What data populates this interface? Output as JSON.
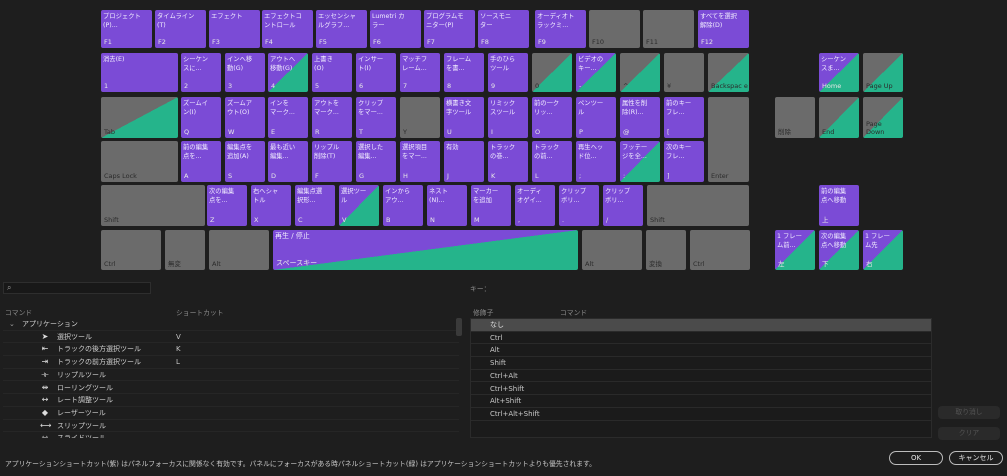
{
  "colors": {
    "application": "#7b4bd6",
    "panel": "#25b48b",
    "unassigned": "#6b6b6b",
    "background": "#1e1e1e"
  },
  "keyboard": {
    "keys": [
      {
        "id": "f1",
        "label": "F1",
        "cmd": "プロジェクト\n(P)...",
        "type": "app"
      },
      {
        "id": "f2",
        "label": "F2",
        "cmd": "タイムライン\n(T)",
        "type": "app"
      },
      {
        "id": "f3",
        "label": "F3",
        "cmd": "エフェクト",
        "type": "app"
      },
      {
        "id": "f4",
        "label": "F4",
        "cmd": "エフェクトコ\nントロール",
        "type": "app"
      },
      {
        "id": "f5",
        "label": "F5",
        "cmd": "エッセンシャ\nルグラフ...",
        "type": "app"
      },
      {
        "id": "f6",
        "label": "F6",
        "cmd": "Lumetri カ\nラー",
        "type": "app"
      },
      {
        "id": "f7",
        "label": "F7",
        "cmd": "プログラムモ\nニター(P)",
        "type": "app"
      },
      {
        "id": "f8",
        "label": "F8",
        "cmd": "ソースモニ\nター",
        "type": "app"
      },
      {
        "id": "f9",
        "label": "F9",
        "cmd": "オーディオト\nラックミ...",
        "type": "app"
      },
      {
        "id": "f10",
        "label": "F10",
        "cmd": "",
        "type": "gray"
      },
      {
        "id": "f11",
        "label": "F11",
        "cmd": "",
        "type": "gray"
      },
      {
        "id": "f12",
        "label": "F12",
        "cmd": "すべてを選択\n解除(D)",
        "type": "app"
      },
      {
        "id": "k1",
        "label": "1",
        "cmd": "消去(E)",
        "type": "app"
      },
      {
        "id": "k2",
        "label": "2",
        "cmd": "シーケン\nスに...",
        "type": "app"
      },
      {
        "id": "k3",
        "label": "3",
        "cmd": "インへ移\n動(G)",
        "type": "app"
      },
      {
        "id": "k4",
        "label": "4",
        "cmd": "アウトへ\n移動(G)",
        "type": "mix app"
      },
      {
        "id": "k5",
        "label": "5",
        "cmd": "上書き\n(O)",
        "type": "app"
      },
      {
        "id": "k6",
        "label": "6",
        "cmd": "インサー\nト(I)",
        "type": "app"
      },
      {
        "id": "k7",
        "label": "7",
        "cmd": "マッチフ\nレーム...",
        "type": "app"
      },
      {
        "id": "k8",
        "label": "8",
        "cmd": "フレーム\nを書...",
        "type": "app"
      },
      {
        "id": "k9",
        "label": "9",
        "cmd": "手のひら\nツール",
        "type": "app"
      },
      {
        "id": "k0",
        "label": "0",
        "cmd": "",
        "type": "mix gray"
      },
      {
        "id": "kminus",
        "label": "-",
        "cmd": "ビデオの\nキー...",
        "type": "mix app"
      },
      {
        "id": "kcaret",
        "label": "^",
        "cmd": "",
        "type": "mix gray"
      },
      {
        "id": "kyen",
        "label": "¥",
        "cmd": "",
        "type": "gray"
      },
      {
        "id": "kbs",
        "label": "Backspac\ne",
        "cmd": "",
        "type": "mix gray"
      },
      {
        "id": "ktab",
        "label": "Tab",
        "cmd": "",
        "type": "mix gray"
      },
      {
        "id": "kq",
        "label": "Q",
        "cmd": "ズームイ\nン(I)",
        "type": "app"
      },
      {
        "id": "kw",
        "label": "W",
        "cmd": "ズームア\nウト(O)",
        "type": "app"
      },
      {
        "id": "ke",
        "label": "E",
        "cmd": "インを\nマーク...",
        "type": "app"
      },
      {
        "id": "kr",
        "label": "R",
        "cmd": "アウトを\nマーク...",
        "type": "app"
      },
      {
        "id": "kt",
        "label": "T",
        "cmd": "クリップ\nをマー...",
        "type": "app"
      },
      {
        "id": "ky",
        "label": "Y",
        "cmd": "",
        "type": "gray"
      },
      {
        "id": "ku",
        "label": "U",
        "cmd": "横書き文\n字ツール",
        "type": "app"
      },
      {
        "id": "ki",
        "label": "I",
        "cmd": "リミック\nスツール",
        "type": "app"
      },
      {
        "id": "ko",
        "label": "O",
        "cmd": "前の一ク\nリッ...",
        "type": "app"
      },
      {
        "id": "kp",
        "label": "P",
        "cmd": "ペンツー\nル",
        "type": "app"
      },
      {
        "id": "kat",
        "label": "@",
        "cmd": "属性を削\n除(R)...",
        "type": "app"
      },
      {
        "id": "klb",
        "label": "[",
        "cmd": "前のキー\nフレ...",
        "type": "app"
      },
      {
        "id": "kenter",
        "label": "Enter",
        "cmd": "",
        "type": "gray"
      },
      {
        "id": "kcaps",
        "label": "Caps Lock",
        "cmd": "",
        "type": "gray"
      },
      {
        "id": "ka",
        "label": "A",
        "cmd": "前の編集\n点を...",
        "type": "app"
      },
      {
        "id": "ks",
        "label": "S",
        "cmd": "編集点を\n追加(A)",
        "type": "app"
      },
      {
        "id": "kd",
        "label": "D",
        "cmd": "最も近い\n編集...",
        "type": "app"
      },
      {
        "id": "kf",
        "label": "F",
        "cmd": "リップル\n削除(T)",
        "type": "app"
      },
      {
        "id": "kg",
        "label": "G",
        "cmd": "選択した\n編集...",
        "type": "app"
      },
      {
        "id": "kh",
        "label": "H",
        "cmd": "選択項目\nをマー...",
        "type": "app"
      },
      {
        "id": "kj",
        "label": "J",
        "cmd": "有効",
        "type": "app"
      },
      {
        "id": "kk",
        "label": "K",
        "cmd": "トラック\nの巻...",
        "type": "app"
      },
      {
        "id": "kl",
        "label": "L",
        "cmd": "トラック\nの前...",
        "type": "app"
      },
      {
        "id": "ksemi",
        "label": ";",
        "cmd": "再生ヘッ\nド位...",
        "type": "app"
      },
      {
        "id": "kcolon",
        "label": ":",
        "cmd": "フッテー\nジを全...",
        "type": "mix app"
      },
      {
        "id": "krb",
        "label": "]",
        "cmd": "次のキー\nフレ...",
        "type": "app"
      },
      {
        "id": "kshiftl",
        "label": "Shift",
        "cmd": "",
        "type": "gray"
      },
      {
        "id": "kz",
        "label": "Z",
        "cmd": "次の編集\n点を...",
        "type": "app"
      },
      {
        "id": "kx",
        "label": "X",
        "cmd": "右へシャ\nトル",
        "type": "app"
      },
      {
        "id": "kc",
        "label": "C",
        "cmd": "編集点選\n択形...",
        "type": "app"
      },
      {
        "id": "kv",
        "label": "V",
        "cmd": "選択ツー\nル",
        "type": "mix app"
      },
      {
        "id": "kb",
        "label": "B",
        "cmd": "インから\nアウ...",
        "type": "app"
      },
      {
        "id": "kn",
        "label": "N",
        "cmd": "ネスト\n(N)...",
        "type": "app"
      },
      {
        "id": "km",
        "label": "M",
        "cmd": "マーカー\nを追加",
        "type": "app"
      },
      {
        "id": "kcomma",
        "label": ",",
        "cmd": "オーディ\nオゲイ...",
        "type": "app"
      },
      {
        "id": "kperiod",
        "label": ".",
        "cmd": "クリップ\nボリ...",
        "type": "app"
      },
      {
        "id": "kslash",
        "label": "/",
        "cmd": "クリップ\nボリ...",
        "type": "app"
      },
      {
        "id": "kshiftr",
        "label": "Shift",
        "cmd": "",
        "type": "gray"
      },
      {
        "id": "kctrl",
        "label": "Ctrl",
        "cmd": "",
        "type": "gray"
      },
      {
        "id": "kmuhenkan",
        "label": "無変",
        "cmd": "",
        "type": "gray"
      },
      {
        "id": "kalt",
        "label": "Alt",
        "cmd": "",
        "type": "gray"
      },
      {
        "id": "kspace",
        "label": "スペースキー",
        "cmd": "再生 / 停止",
        "type": "space"
      },
      {
        "id": "kaltr",
        "label": "Alt",
        "cmd": "",
        "type": "gray"
      },
      {
        "id": "khenkan",
        "label": "変換",
        "cmd": "",
        "type": "gray"
      },
      {
        "id": "kctrlr",
        "label": "Ctrl",
        "cmd": "",
        "type": "gray"
      },
      {
        "id": "khome",
        "label": "Home",
        "cmd": "シーケン\nスま...",
        "type": "mix app"
      },
      {
        "id": "kpgup",
        "label": "Page Up",
        "cmd": "",
        "type": "mix gray"
      },
      {
        "id": "kdel",
        "label": "削除",
        "cmd": "",
        "type": "gray"
      },
      {
        "id": "kend",
        "label": "End",
        "cmd": "",
        "type": "mix gray"
      },
      {
        "id": "kpgdn",
        "label": "Page\nDown",
        "cmd": "",
        "type": "mix gray"
      },
      {
        "id": "kup",
        "label": "上",
        "cmd": "前の編集\n点へ移動",
        "type": "app"
      },
      {
        "id": "kleft",
        "label": "左",
        "cmd": "1 フレー\nム前...",
        "type": "mix app"
      },
      {
        "id": "kdown",
        "label": "下",
        "cmd": "次の編集\n点へ移動",
        "type": "mix app"
      },
      {
        "id": "kright",
        "label": "右",
        "cmd": "1 フレー\nム先",
        "type": "mix app"
      }
    ]
  },
  "search": {
    "value": ""
  },
  "left_headers": {
    "command": "コマンド",
    "shortcut": "ショートカット"
  },
  "right_headers": {
    "key": "キー：",
    "modifier": "修飾子",
    "command": "コマンド"
  },
  "commands": [
    {
      "group": true,
      "name": "アプリケーション",
      "shortcut": "",
      "icon": ""
    },
    {
      "name": "選択ツール",
      "shortcut": "V",
      "icon": "➤"
    },
    {
      "name": "トラックの後方選択ツール",
      "shortcut": "K",
      "icon": "⇤"
    },
    {
      "name": "トラックの前方選択ツール",
      "shortcut": "L",
      "icon": "⇥"
    },
    {
      "name": "リップルツール",
      "shortcut": "",
      "icon": "⟛"
    },
    {
      "name": "ローリングツール",
      "shortcut": "",
      "icon": "⇹"
    },
    {
      "name": "レート調整ツール",
      "shortcut": "",
      "icon": "↔"
    },
    {
      "name": "レーザーツール",
      "shortcut": "",
      "icon": "◆"
    },
    {
      "name": "スリップツール",
      "shortcut": "",
      "icon": "⟷"
    },
    {
      "name": "スライドツール",
      "shortcut": "",
      "icon": "⇿"
    }
  ],
  "modifiers": [
    "なし",
    "Ctrl",
    "Alt",
    "Shift",
    "Ctrl+Alt",
    "Ctrl+Shift",
    "Alt+Shift",
    "Ctrl+Alt+Shift"
  ],
  "side_buttons": {
    "remove": "取り消し",
    "clear": "クリア"
  },
  "footer": {
    "note": "アプリケーションショートカット(紫) はパネルフォーカスに関係なく有効です。パネルにフォーカスがある時パネルショートカット(緑) はアプリケーションショートカットよりも優先されます。",
    "ok": "OK",
    "cancel": "キャンセル"
  }
}
